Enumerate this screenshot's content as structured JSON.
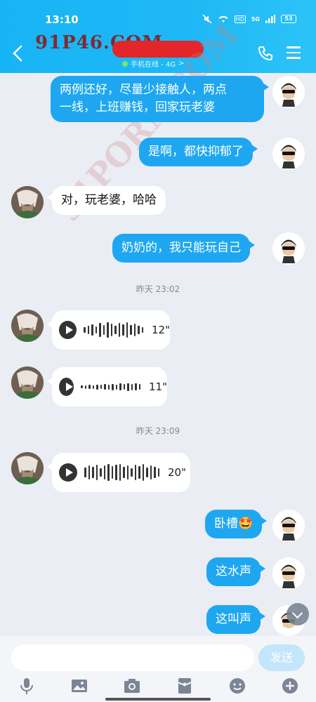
{
  "status_bar": {
    "time": "13:10",
    "network": "HD",
    "signal": "5G",
    "battery": "53"
  },
  "header": {
    "subtitle": "手机在线 - 4G",
    "subtitle_chevron": ">"
  },
  "watermark": {
    "text": "91P46.COM",
    "text2": "91PORN.COM"
  },
  "messages": [
    {
      "side": "me",
      "text_line1": "两例还好，尽量少接触人，两点",
      "text_line2": "一线，上班赚钱，回家玩老婆"
    },
    {
      "side": "me",
      "text": "是啊，都快抑郁了"
    },
    {
      "side": "other",
      "text": "对，玩老婆，哈哈"
    },
    {
      "side": "me",
      "text": "奶奶的，我只能玩自己"
    },
    {
      "timestamp": "昨天 23:02"
    },
    {
      "side": "other",
      "voice_duration": "12\""
    },
    {
      "side": "other",
      "voice_duration": "11\""
    },
    {
      "timestamp": "昨天 23:09"
    },
    {
      "side": "other",
      "voice_duration": "20\""
    },
    {
      "side": "me",
      "text": "卧槽🤩"
    },
    {
      "side": "me",
      "text": "这水声"
    },
    {
      "side": "me",
      "text": "这叫声"
    }
  ],
  "input": {
    "placeholder": "",
    "value": "",
    "send_label": "发送"
  },
  "toolbar_icons": [
    "microphone-icon",
    "image-icon",
    "camera-icon",
    "red-packet-icon",
    "emoji-icon",
    "plus-icon"
  ],
  "colors": {
    "header": "#1fb8f6",
    "my_bubble": "#1ea7f0",
    "background": "#eaedf3",
    "send_disabled": "#c3e6fb"
  }
}
